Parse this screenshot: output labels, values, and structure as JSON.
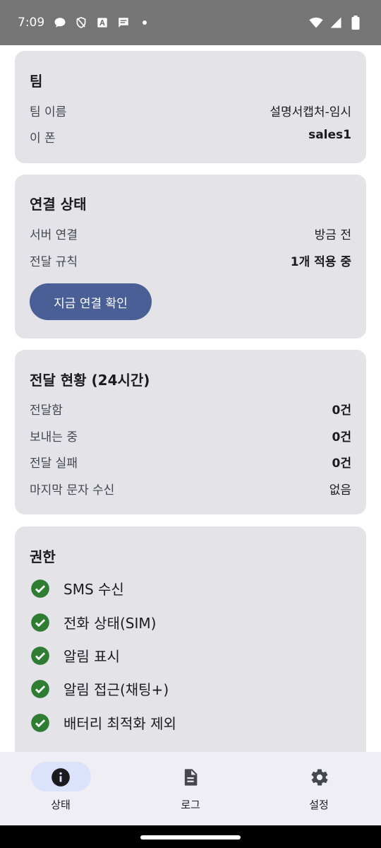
{
  "status_bar": {
    "time": "7:09"
  },
  "team_card": {
    "title": "팀",
    "rows": [
      {
        "label": "팀 이름",
        "value": "설명서캡처-임시"
      },
      {
        "label": "이 폰",
        "value": "sales1"
      }
    ]
  },
  "connection_card": {
    "title": "연결 상태",
    "rows": [
      {
        "label": "서버 연결",
        "value": "방금 전"
      },
      {
        "label": "전달 규칙",
        "value": "1개 적용 중"
      }
    ],
    "button_label": "지금 연결 확인"
  },
  "delivery_card": {
    "title": "전달 현황 (24시간)",
    "rows": [
      {
        "label": "전달함",
        "value": "0건"
      },
      {
        "label": "보내는 중",
        "value": "0건"
      },
      {
        "label": "전달 실패",
        "value": "0건"
      },
      {
        "label": "마지막 문자 수신",
        "value": "없음"
      }
    ]
  },
  "permissions_card": {
    "title": "권한",
    "items": [
      {
        "label": "SMS 수신",
        "status": "granted"
      },
      {
        "label": "전화 상태(SIM)",
        "status": "granted"
      },
      {
        "label": "알림 표시",
        "status": "granted"
      },
      {
        "label": "알림 접근(채팅+)",
        "status": "granted"
      },
      {
        "label": "배터리 최적화 제외",
        "status": "granted"
      }
    ]
  },
  "bottom_nav": {
    "items": [
      {
        "label": "상태",
        "icon": "info-icon",
        "selected": true
      },
      {
        "label": "로그",
        "icon": "document-icon",
        "selected": false
      },
      {
        "label": "설정",
        "icon": "gear-icon",
        "selected": false
      }
    ]
  },
  "colors": {
    "card_bg": "#e4e3e8",
    "button_bg": "#4a5f95",
    "check_green": "#2e7d32",
    "nav_selected_pill": "#dce2f9"
  }
}
